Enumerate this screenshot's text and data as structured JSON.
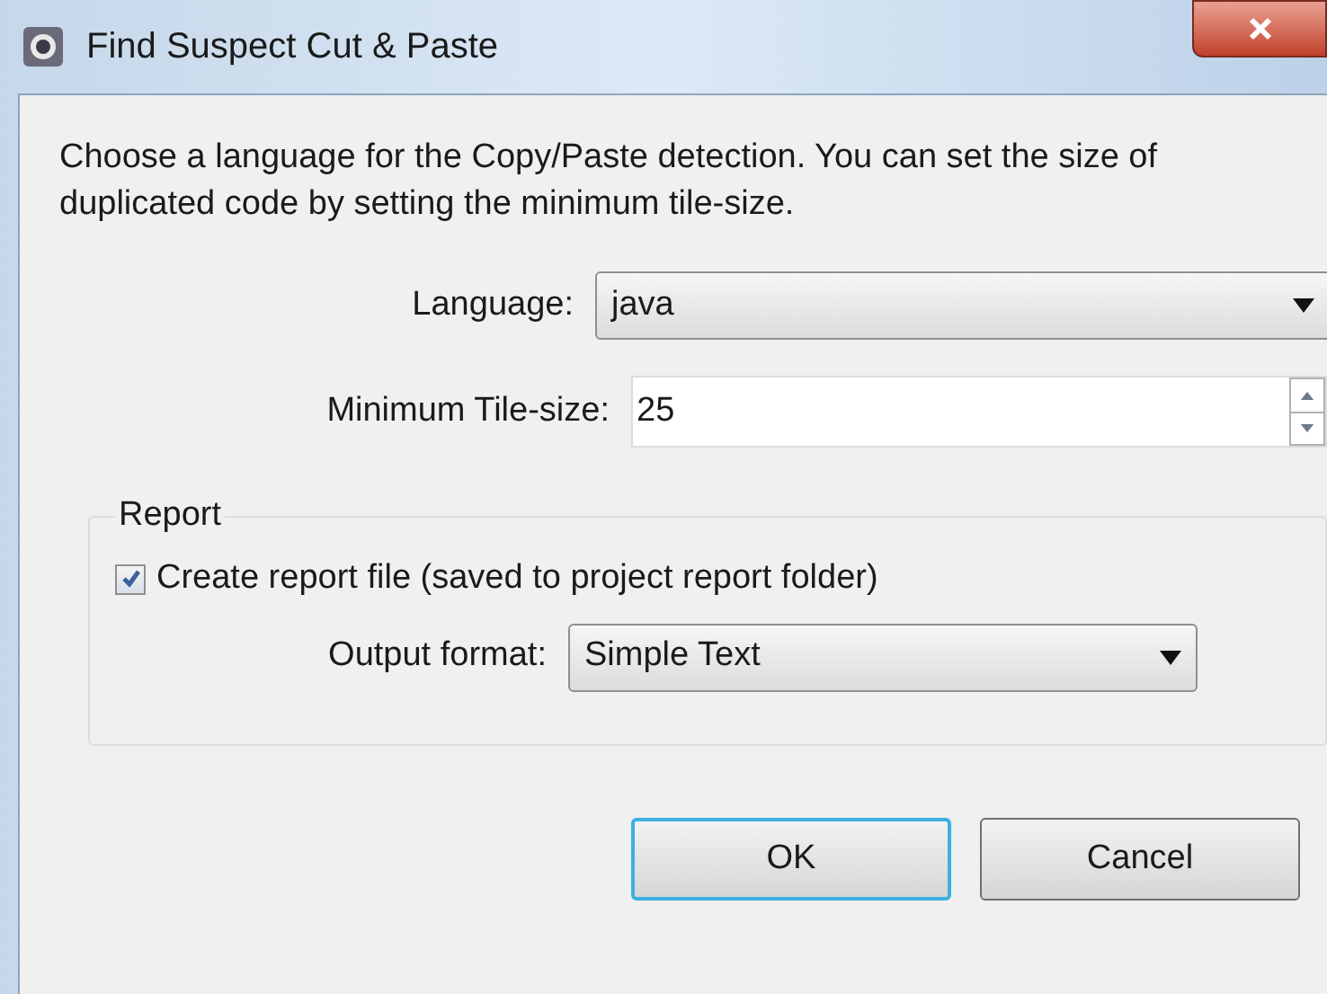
{
  "window": {
    "title": "Find Suspect Cut & Paste"
  },
  "description": "Choose a language for the Copy/Paste detection. You can set the size of duplicated code by setting the minimum tile-size.",
  "language": {
    "label": "Language:",
    "value": "java"
  },
  "tile_size": {
    "label": "Minimum Tile-size:",
    "value": "25"
  },
  "report": {
    "title": "Report",
    "create_file": {
      "label": "Create report file (saved to project report folder)",
      "checked": true
    },
    "output_format": {
      "label": "Output format:",
      "value": "Simple Text"
    }
  },
  "buttons": [
    {
      "label": "OK",
      "default": true
    },
    {
      "label": "Cancel",
      "default": false
    }
  ]
}
